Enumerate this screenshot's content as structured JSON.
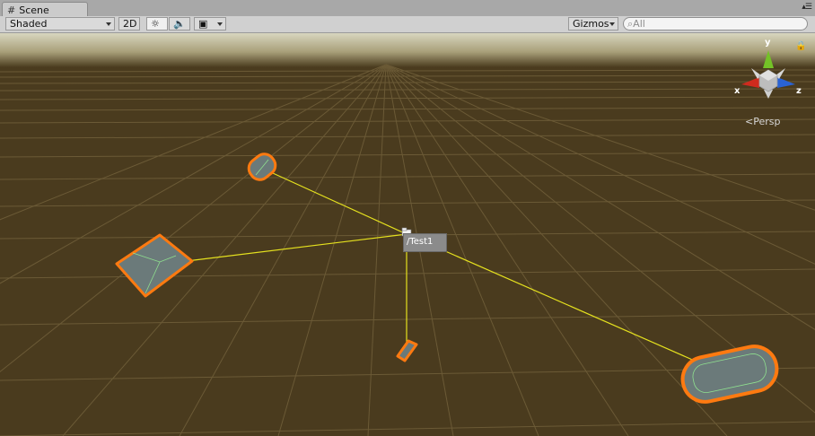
{
  "tab": {
    "title": "Scene"
  },
  "toolbar": {
    "draw_mode": "Shaded",
    "mode_2d": "2D",
    "gizmos": "Gizmos",
    "search_placeholder": "All"
  },
  "scene": {
    "object_label": "/Test1",
    "projection": "Persp",
    "axes": {
      "x": "x",
      "y": "y",
      "z": "z"
    }
  },
  "colors": {
    "ground": "#4a3b1e",
    "sky": "#d3d1b9",
    "outline": "#ff7a10",
    "link_line": "#e5e11e",
    "axis_x": "#cf2b1e",
    "axis_y": "#74c227",
    "axis_z": "#2a63d4"
  }
}
